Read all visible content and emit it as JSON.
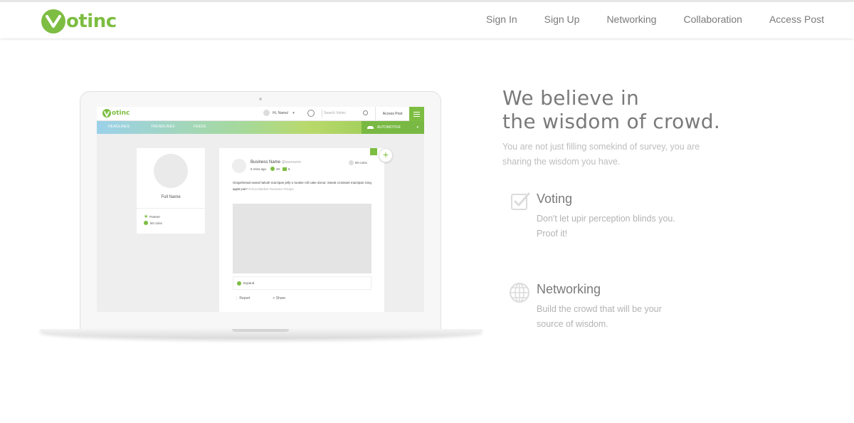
{
  "brand": {
    "logo_text": "otinc",
    "logo_initial": "V",
    "accent_color": "#7dbd42"
  },
  "nav": {
    "items": [
      "Sign In",
      "Sign Up",
      "Networking",
      "Collaboration",
      "Access Post"
    ]
  },
  "hero": {
    "title_line1": "We believe in",
    "title_line2": "the wisdom of crowd.",
    "subtitle": "You are not just filling somekind of survey, you are sharing the wisdom you have."
  },
  "features": [
    {
      "icon": "check-icon",
      "title": "Voting",
      "text": "Don't let upir perception blinds you. Proof it!"
    },
    {
      "icon": "globe-icon",
      "title": "Networking",
      "text": "Build the crowd that will be your source of wisdom."
    }
  ],
  "mockup": {
    "logo_text": "otinc",
    "logo_initial": "V",
    "user_greeting": "Hi, Nama!",
    "search_placeholder": "Search Votinc",
    "access_post": "Access Post",
    "tabs": [
      "HEADLINES",
      "TRENDLINES",
      "FEEDS"
    ],
    "category": "AUTOMOTIVE",
    "profile": {
      "name": "Full Name",
      "badge": "Partner",
      "coins": "50 coins"
    },
    "post": {
      "business_name": "Business Name",
      "handle": "@username",
      "time": "5 mins ago",
      "votes": "20",
      "comments": "5",
      "coins": "50 coins",
      "text": "Gingerbread sweat halvah marzipan jelly-o tootsie roll cake donut. Sweat croissant marzipan icing apple pie?",
      "tags": "#chocolatebar #sesame #snaps",
      "expand": "Expand",
      "report": "Report",
      "share": "Share"
    }
  }
}
